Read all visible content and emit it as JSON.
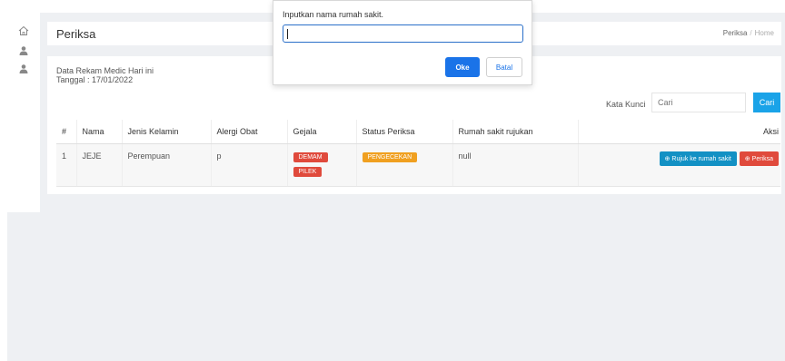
{
  "header": {
    "title": "Periksa",
    "breadcrumb": {
      "current": "Periksa",
      "separator": "/",
      "home": "Home"
    }
  },
  "sidebar": {
    "icons": [
      "home-icon",
      "user-icon",
      "user-icon"
    ]
  },
  "info": {
    "line1": "Data Rekam Medic Hari ini",
    "line2": "Tanggal : 17/01/2022"
  },
  "search": {
    "label": "Kata Kunci",
    "placeholder": "Cari",
    "button": "Cari"
  },
  "table": {
    "columns": [
      "#",
      "Nama",
      "Jenis Kelamin",
      "Alergi Obat",
      "Gejala",
      "Status Periksa",
      "Rumah sakit rujukan",
      "Aksi"
    ],
    "rows": [
      {
        "no": "1",
        "nama": "JEJE",
        "jenis_kelamin": "Perempuan",
        "alergi_obat": "p",
        "gejala": [
          "DEMAM",
          "PILEK"
        ],
        "status": "PENGECEKAN",
        "rujukan": "null",
        "actions": {
          "rujuk": "Rujuk ke rumah sakit",
          "periksa": "Periksa"
        }
      }
    ]
  },
  "dialog": {
    "message": "Inputkan nama rumah sakit.",
    "value": "",
    "ok": "Oke",
    "cancel": "Batal"
  },
  "colors": {
    "primary": "#1aa3e8",
    "danger": "#e04a3c",
    "warning": "#f0a020",
    "dialog_primary": "#1a73e8"
  }
}
